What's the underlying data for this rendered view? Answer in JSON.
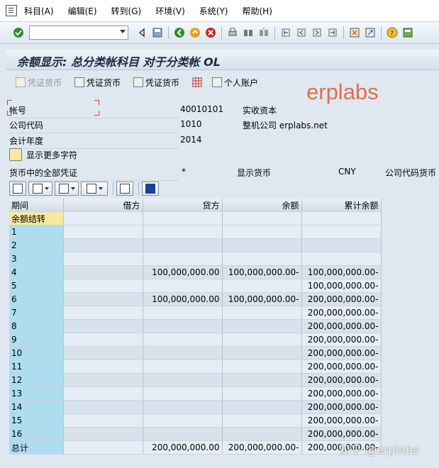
{
  "menu": {
    "items": [
      "科目(A)",
      "编辑(E)",
      "转到(G)",
      "环境(V)",
      "系统(Y)",
      "帮助(H)"
    ]
  },
  "toolbar": {
    "command_value": ""
  },
  "title": "余额显示: 总分类帐科目 对于分类帐 OL",
  "appbar": {
    "btn1": "凭证货币",
    "btn2": "凭证货币",
    "btn3": "凭证货币",
    "btn4": "个人账户"
  },
  "brand": "erplabs",
  "header": {
    "account_label": "帐号",
    "account_value": "40010101",
    "account_desc": "实收资本",
    "company_label": "公司代码",
    "company_value": "1010",
    "company_desc": "整机公司 erplabs.net",
    "year_label": "会计年度",
    "year_value": "2014",
    "more_fields": "显示更多字符",
    "all_docs_label": "货币中的全部凭证",
    "all_docs_value": "*",
    "display_currency_label": "显示货币",
    "display_currency_value": "CNY",
    "company_currency_label": "公司代码货币"
  },
  "table": {
    "columns": [
      "期间",
      "借方",
      "贷方",
      "余额",
      "累计余额"
    ],
    "rows": [
      [
        "余额结转",
        "",
        "",
        "",
        ""
      ],
      [
        "1",
        "",
        "",
        "",
        ""
      ],
      [
        "2",
        "",
        "",
        "",
        ""
      ],
      [
        "3",
        "",
        "",
        "",
        ""
      ],
      [
        "4",
        "",
        "100,000,000.00",
        "100,000,000.00-",
        "100,000,000.00-"
      ],
      [
        "5",
        "",
        "",
        "",
        "100,000,000.00-"
      ],
      [
        "6",
        "",
        "100,000,000.00",
        "100,000,000.00-",
        "200,000,000.00-"
      ],
      [
        "7",
        "",
        "",
        "",
        "200,000,000.00-"
      ],
      [
        "8",
        "",
        "",
        "",
        "200,000,000.00-"
      ],
      [
        "9",
        "",
        "",
        "",
        "200,000,000.00-"
      ],
      [
        "10",
        "",
        "",
        "",
        "200,000,000.00-"
      ],
      [
        "11",
        "",
        "",
        "",
        "200,000,000.00-"
      ],
      [
        "12",
        "",
        "",
        "",
        "200,000,000.00-"
      ],
      [
        "13",
        "",
        "",
        "",
        "200,000,000.00-"
      ],
      [
        "14",
        "",
        "",
        "",
        "200,000,000.00-"
      ],
      [
        "15",
        "",
        "",
        "",
        "200,000,000.00-"
      ],
      [
        "16",
        "",
        "",
        "",
        "200,000,000.00-"
      ],
      [
        "总计",
        "",
        "200,000,000.00",
        "200,000,000.00-",
        "200,000,000.00-"
      ]
    ]
  },
  "watermark": "知乎 @erplabs",
  "colors": {
    "brand": "#e36c4d",
    "period_cell": "#aeddf0",
    "selected_cell": "#f8e9a1"
  }
}
